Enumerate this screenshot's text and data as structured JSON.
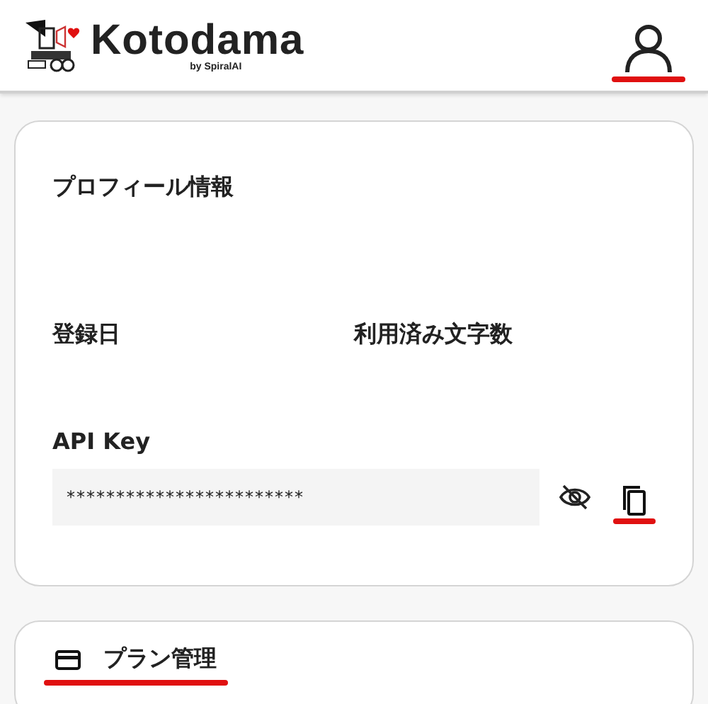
{
  "header": {
    "logo_text": "Kotodama",
    "logo_subtext": "by SpiralAI"
  },
  "profile": {
    "title": "プロフィール情報",
    "fields": [
      {
        "label": "登録日"
      },
      {
        "label": "利用済み文字数"
      }
    ],
    "api_key": {
      "label": "API Key",
      "value": "************************",
      "masked": true
    }
  },
  "plan": {
    "label": "プラン管理"
  }
}
